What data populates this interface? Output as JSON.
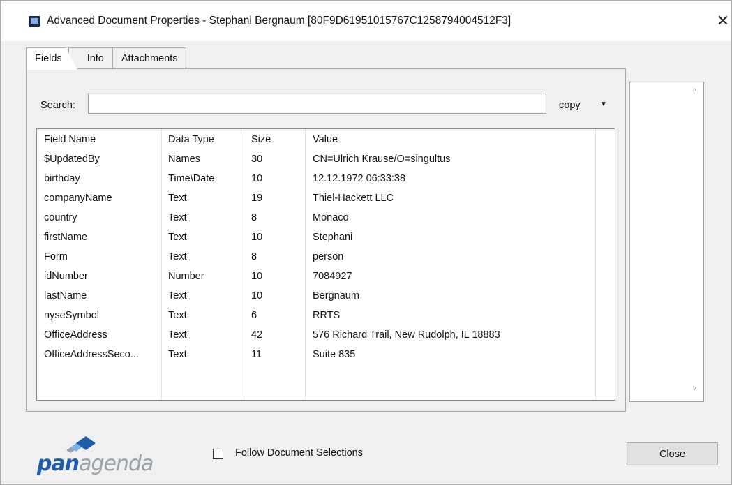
{
  "window": {
    "title": "Advanced Document Properties - Stephani Bergnaum [80F9D61951015767C1258794004512F3]",
    "close_glyph": "✕"
  },
  "tabs": [
    {
      "label": "Fields",
      "active": true
    },
    {
      "label": "Info",
      "active": false
    },
    {
      "label": "Attachments",
      "active": false
    }
  ],
  "search": {
    "label": "Search:",
    "value": "",
    "placeholder": ""
  },
  "copy": {
    "label": "copy",
    "arrow": "▼"
  },
  "table": {
    "columns": [
      "Field Name",
      "Data Type",
      "Size",
      "Value"
    ],
    "rows": [
      [
        "$UpdatedBy",
        "Names",
        "30",
        "CN=Ulrich Krause/O=singultus"
      ],
      [
        "birthday",
        "Time\\Date",
        "10",
        "12.12.1972 06:33:38"
      ],
      [
        "companyName",
        "Text",
        "19",
        "Thiel-Hackett LLC"
      ],
      [
        "country",
        "Text",
        "8",
        "Monaco"
      ],
      [
        "firstName",
        "Text",
        "10",
        "Stephani"
      ],
      [
        "Form",
        "Text",
        "8",
        "person"
      ],
      [
        "idNumber",
        "Number",
        "10",
        "7084927"
      ],
      [
        "lastName",
        "Text",
        "10",
        "Bergnaum"
      ],
      [
        "nyseSymbol",
        "Text",
        "6",
        "RRTS"
      ],
      [
        "OfficeAddress",
        "Text",
        "42",
        "576 Richard Trail, New Rudolph, IL 18883"
      ],
      [
        "OfficeAddressSeco...",
        "Text",
        "11",
        "Suite 835"
      ]
    ]
  },
  "side_scroll": {
    "up": "^",
    "down": "v"
  },
  "logo": {
    "bold": "pan",
    "light": "agenda"
  },
  "follow": {
    "label": "Follow Document Selections",
    "checked": false
  },
  "close_button": {
    "label": "Close"
  },
  "colors": {
    "logo_blue": "#1f5ea8",
    "logo_gray": "#9aa2ac",
    "diamond_light": "#7fb2e6"
  }
}
